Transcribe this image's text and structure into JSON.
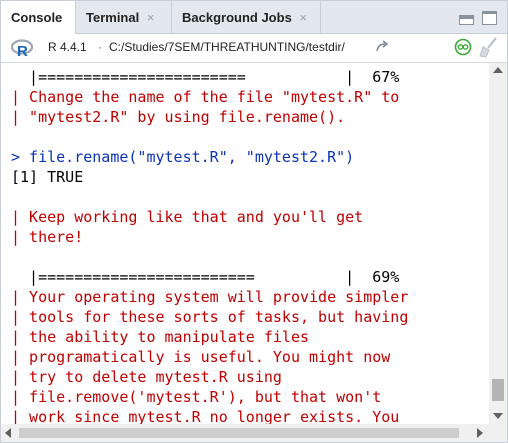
{
  "tabs": [
    {
      "label": "Console",
      "close": ""
    },
    {
      "label": "Terminal",
      "close": "×"
    },
    {
      "label": "Background Jobs",
      "close": "×"
    }
  ],
  "pathbar": {
    "r_version": "R 4.4.1",
    "separator": "·",
    "working_dir": "C:/Studies/7SEM/THREATHUNTING/testdir/"
  },
  "console": {
    "lines": [
      "  |=======================           |  67%",
      "| Change the name of the file \"mytest.R\" to",
      "| \"mytest2.R\" by using file.rename().",
      "",
      "> file.rename(\"mytest.R\", \"mytest2.R\")",
      "[1] TRUE",
      "",
      "| Keep working like that and you'll get",
      "| there!",
      "",
      "  |========================          |  69%",
      "| Your operating system will provide simpler",
      "| tools for these sorts of tasks, but having",
      "| the ability to manipulate files",
      "| programatically is useful. You might now",
      "| try to delete mytest.R using",
      "| file.remove('mytest.R'), but that won't",
      "| work since mytest.R no longer exists. You"
    ]
  },
  "colors": {
    "message": "#c00000",
    "input": "#0b34b6",
    "output": "#000000",
    "tab_bar": "#e3e8ee"
  },
  "icons": {
    "r_logo": "r-logo",
    "goto_dir": "goto-directory-arrow-icon",
    "interrupt": "interrupt-r-icon",
    "clear_console": "clear-console-broom-icon",
    "minimize": "minimize-pane-icon",
    "maximize": "maximize-pane-icon"
  }
}
